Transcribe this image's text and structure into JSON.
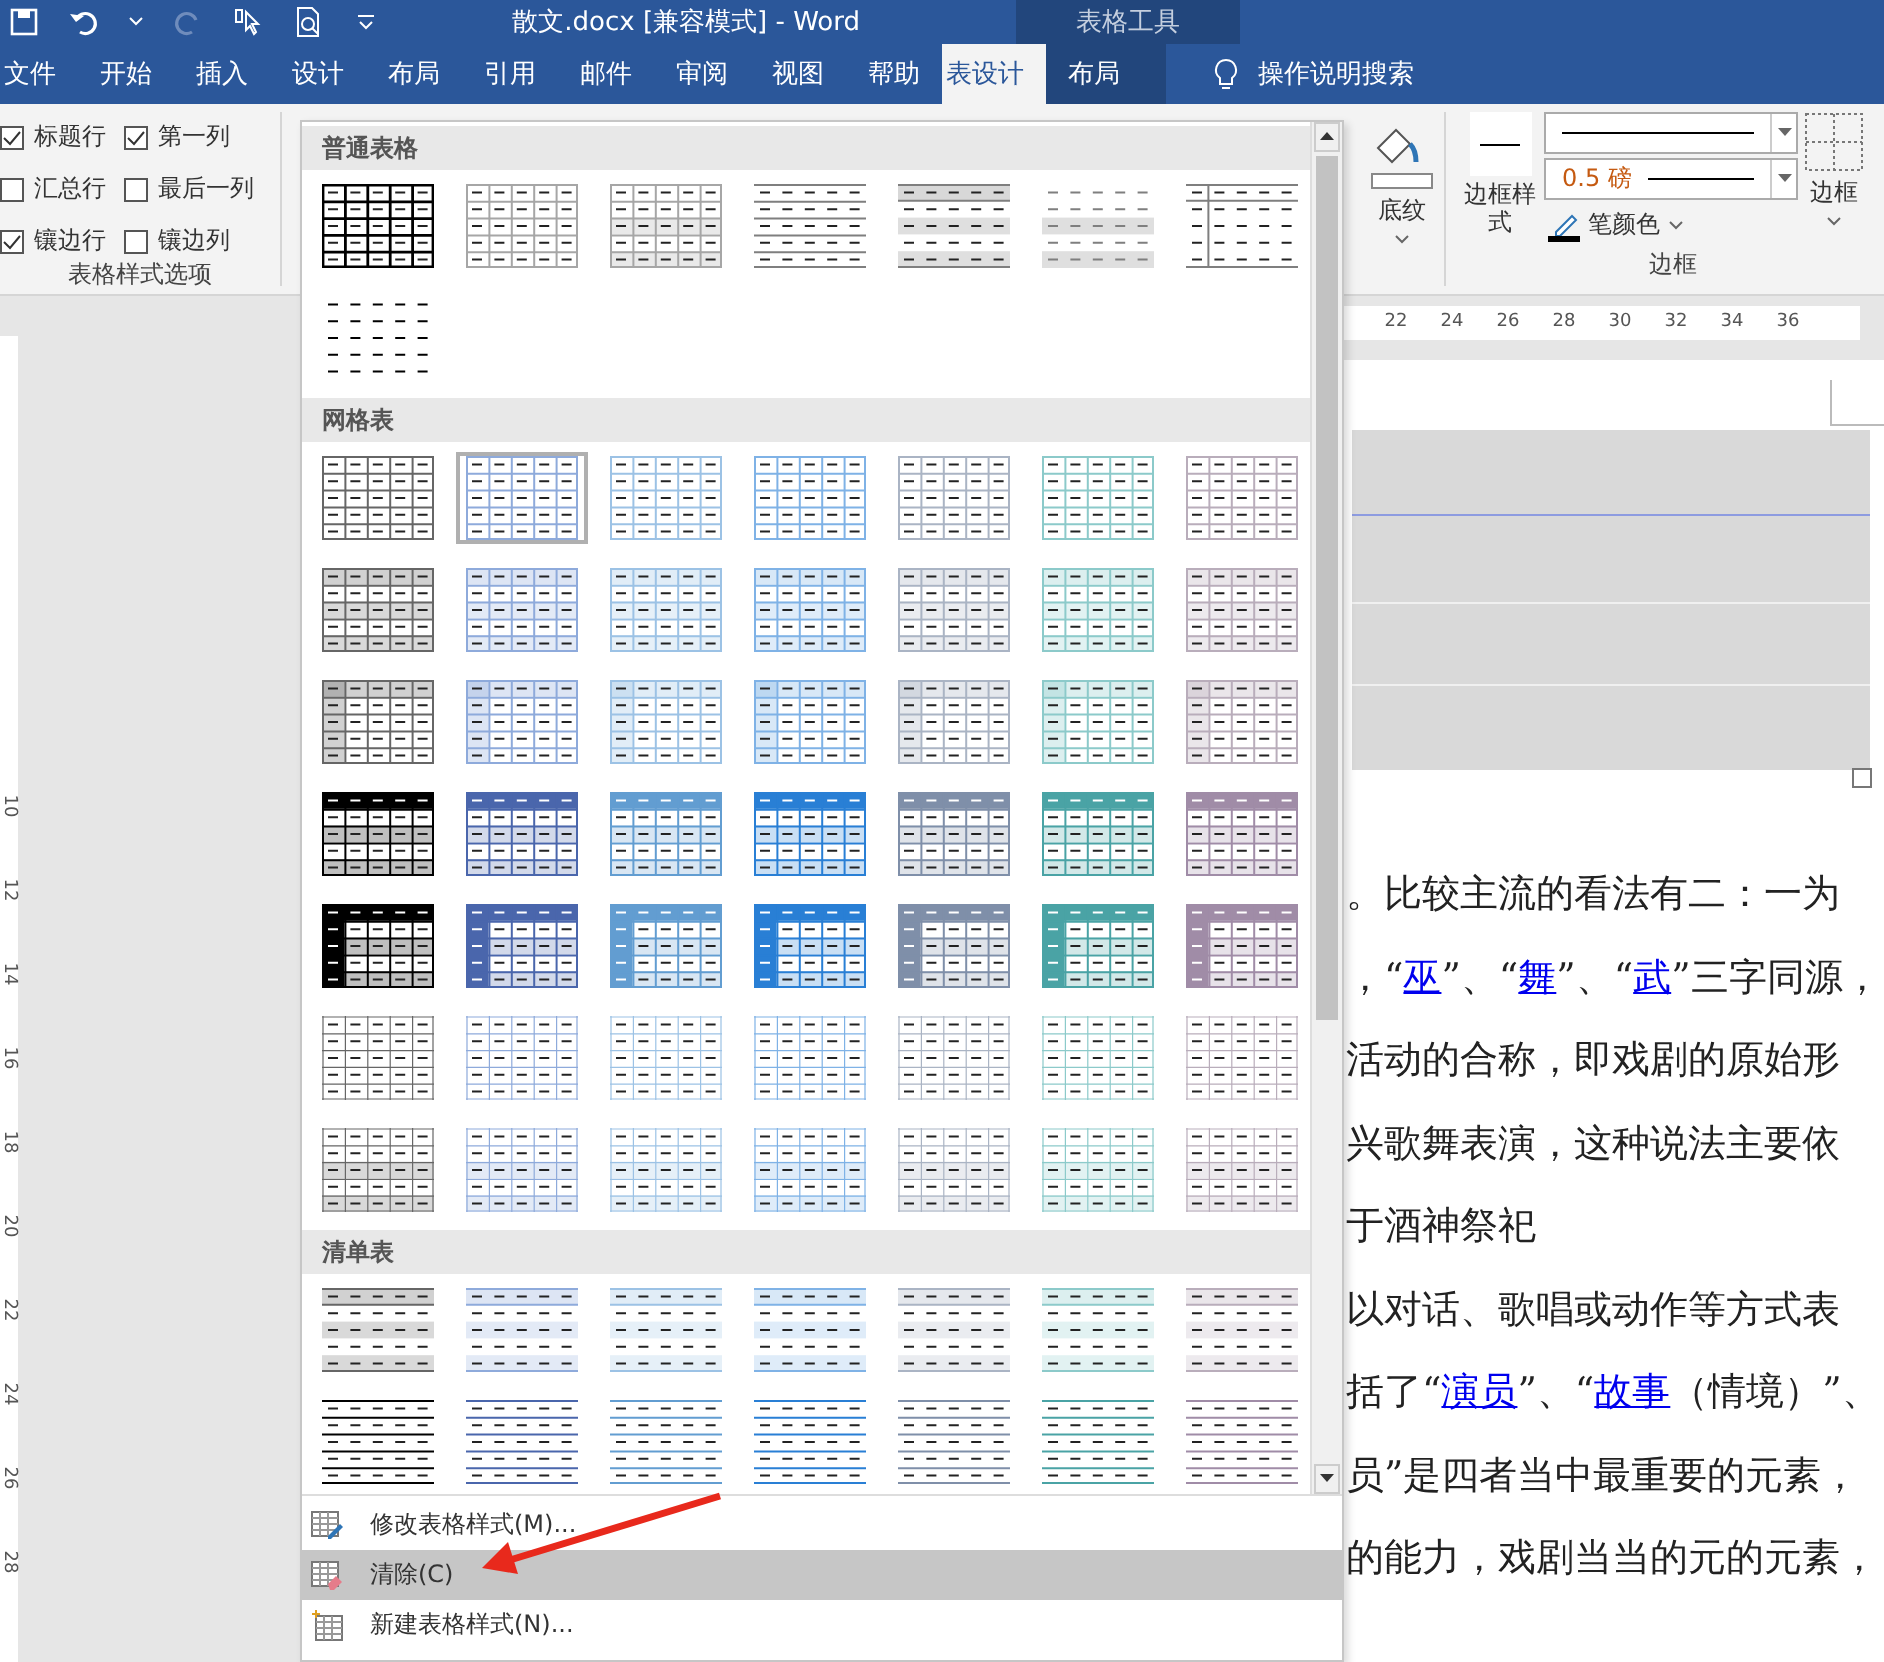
{
  "window": {
    "title": "散文.docx [兼容模式]  -  Word",
    "context_label": "表格工具"
  },
  "tabs": [
    {
      "label": "文件",
      "selected": false,
      "context": false
    },
    {
      "label": "开始",
      "selected": false,
      "context": false
    },
    {
      "label": "插入",
      "selected": false,
      "context": false
    },
    {
      "label": "设计",
      "selected": false,
      "context": false
    },
    {
      "label": "布局",
      "selected": false,
      "context": false
    },
    {
      "label": "引用",
      "selected": false,
      "context": false
    },
    {
      "label": "邮件",
      "selected": false,
      "context": false
    },
    {
      "label": "审阅",
      "selected": false,
      "context": false
    },
    {
      "label": "视图",
      "selected": false,
      "context": false
    },
    {
      "label": "帮助",
      "selected": false,
      "context": false
    },
    {
      "label": "表设计",
      "selected": true,
      "context": true
    },
    {
      "label": "布局",
      "selected": false,
      "context": true
    }
  ],
  "tell_me": "操作说明搜索",
  "style_options": {
    "label": "表格样式选项",
    "items": [
      {
        "label": "标题行",
        "checked": true
      },
      {
        "label": "第一列",
        "checked": true
      },
      {
        "label": "汇总行",
        "checked": false
      },
      {
        "label": "最后一列",
        "checked": false
      },
      {
        "label": "镶边行",
        "checked": true
      },
      {
        "label": "镶边列",
        "checked": false
      }
    ]
  },
  "shading": {
    "label": "底纹"
  },
  "borders": {
    "label": "边框",
    "style_button": "边框样式",
    "weight": "0.5 磅",
    "pen_color": "笔颜色",
    "borders_button": "边框"
  },
  "style_gallery": {
    "sections": [
      {
        "title": "普通表格",
        "styles": [
          {
            "kind": "grid-bold",
            "color": "#000000",
            "selected": false
          },
          {
            "kind": "grid",
            "color": "#a6a6a6",
            "selected": false
          },
          {
            "kind": "grid-banded",
            "color": "#a6a6a6",
            "selected": false
          },
          {
            "kind": "lines",
            "color": "#7f7f7f",
            "selected": false
          },
          {
            "kind": "list-banded",
            "color": "#7f7f7f",
            "selected": false
          },
          {
            "kind": "banded",
            "color": "#7f7f7f",
            "selected": false
          },
          {
            "kind": "firstcol",
            "color": "#7f7f7f",
            "selected": false
          },
          {
            "kind": "plain",
            "color": "#000000",
            "selected": false
          }
        ]
      },
      {
        "title": "网格表",
        "styles": [
          {
            "kind": "grid",
            "color": "#666666",
            "selected": false
          },
          {
            "kind": "grid",
            "color": "#8eaadb",
            "selected": true
          },
          {
            "kind": "grid",
            "color": "#9cc2e5",
            "selected": false
          },
          {
            "kind": "grid",
            "color": "#7fb2e6",
            "selected": false
          },
          {
            "kind": "grid",
            "color": "#aab4c4",
            "selected": false
          },
          {
            "kind": "grid",
            "color": "#8ccaca",
            "selected": false
          },
          {
            "kind": "grid",
            "color": "#b9adbb",
            "selected": false
          },
          {
            "kind": "grid-header-banded",
            "color": "#666666",
            "selected": false
          },
          {
            "kind": "grid-header-banded",
            "color": "#8eaadb",
            "selected": false
          },
          {
            "kind": "grid-header-banded",
            "color": "#9cc2e5",
            "selected": false
          },
          {
            "kind": "grid-header-banded",
            "color": "#7fb2e6",
            "selected": false
          },
          {
            "kind": "grid-header-banded",
            "color": "#aab4c4",
            "selected": false
          },
          {
            "kind": "grid-header-banded",
            "color": "#8ccaca",
            "selected": false
          },
          {
            "kind": "grid-header-banded",
            "color": "#b9adbb",
            "selected": false
          },
          {
            "kind": "grid-firstcol",
            "color": "#666666",
            "selected": false
          },
          {
            "kind": "grid-firstcol",
            "color": "#8eaadb",
            "selected": false
          },
          {
            "kind": "grid-firstcol",
            "color": "#9cc2e5",
            "selected": false
          },
          {
            "kind": "grid-firstcol",
            "color": "#7fb2e6",
            "selected": false
          },
          {
            "kind": "grid-firstcol",
            "color": "#aab4c4",
            "selected": false
          },
          {
            "kind": "grid-firstcol",
            "color": "#8ccaca",
            "selected": false
          },
          {
            "kind": "grid-firstcol",
            "color": "#b9adbb",
            "selected": false
          },
          {
            "kind": "grid-dark-header",
            "color": "#000000",
            "selected": false
          },
          {
            "kind": "grid-dark-header",
            "color": "#4a66ac",
            "selected": false
          },
          {
            "kind": "grid-dark-header",
            "color": "#629dd1",
            "selected": false
          },
          {
            "kind": "grid-dark-header",
            "color": "#297fd5",
            "selected": false
          },
          {
            "kind": "grid-dark-header",
            "color": "#7f8fa9",
            "selected": false
          },
          {
            "kind": "grid-dark-header",
            "color": "#4aa3a5",
            "selected": false
          },
          {
            "kind": "grid-dark-header",
            "color": "#a08ca7",
            "selected": false
          },
          {
            "kind": "grid-dark-both",
            "color": "#000000",
            "selected": false
          },
          {
            "kind": "grid-dark-both",
            "color": "#4a66ac",
            "selected": false
          },
          {
            "kind": "grid-dark-both",
            "color": "#629dd1",
            "selected": false
          },
          {
            "kind": "grid-dark-both",
            "color": "#297fd5",
            "selected": false
          },
          {
            "kind": "grid-dark-both",
            "color": "#7f8fa9",
            "selected": false
          },
          {
            "kind": "grid-dark-both",
            "color": "#4aa3a5",
            "selected": false
          },
          {
            "kind": "grid-dark-both",
            "color": "#a08ca7",
            "selected": false
          },
          {
            "kind": "grid-light",
            "color": "#666666",
            "selected": false
          },
          {
            "kind": "grid-light",
            "color": "#8eaadb",
            "selected": false
          },
          {
            "kind": "grid-light",
            "color": "#9cc2e5",
            "selected": false
          },
          {
            "kind": "grid-light",
            "color": "#7fb2e6",
            "selected": false
          },
          {
            "kind": "grid-light",
            "color": "#aab4c4",
            "selected": false
          },
          {
            "kind": "grid-light",
            "color": "#8ccaca",
            "selected": false
          },
          {
            "kind": "grid-light",
            "color": "#b9adbb",
            "selected": false
          },
          {
            "kind": "grid-light-banded",
            "color": "#666666",
            "selected": false
          },
          {
            "kind": "grid-light-banded",
            "color": "#8eaadb",
            "selected": false
          },
          {
            "kind": "grid-light-banded",
            "color": "#9cc2e5",
            "selected": false
          },
          {
            "kind": "grid-light-banded",
            "color": "#7fb2e6",
            "selected": false
          },
          {
            "kind": "grid-light-banded",
            "color": "#aab4c4",
            "selected": false
          },
          {
            "kind": "grid-light-banded",
            "color": "#8ccaca",
            "selected": false
          },
          {
            "kind": "grid-light-banded",
            "color": "#b9adbb",
            "selected": false
          }
        ]
      },
      {
        "title": "清单表",
        "styles": [
          {
            "kind": "list-banded",
            "color": "#666666",
            "selected": false
          },
          {
            "kind": "list-banded",
            "color": "#8eaadb",
            "selected": false
          },
          {
            "kind": "list-banded",
            "color": "#9cc2e5",
            "selected": false
          },
          {
            "kind": "list-banded",
            "color": "#7fb2e6",
            "selected": false
          },
          {
            "kind": "list-banded",
            "color": "#aab4c4",
            "selected": false
          },
          {
            "kind": "list-banded",
            "color": "#8ccaca",
            "selected": false
          },
          {
            "kind": "list-banded",
            "color": "#b9adbb",
            "selected": false
          },
          {
            "kind": "lines",
            "color": "#000000",
            "selected": false
          },
          {
            "kind": "lines",
            "color": "#4a66ac",
            "selected": false
          },
          {
            "kind": "lines",
            "color": "#629dd1",
            "selected": false
          },
          {
            "kind": "lines",
            "color": "#297fd5",
            "selected": false
          },
          {
            "kind": "lines",
            "color": "#7f8fa9",
            "selected": false
          },
          {
            "kind": "lines",
            "color": "#4aa3a5",
            "selected": false
          },
          {
            "kind": "lines",
            "color": "#a08ca7",
            "selected": false
          }
        ]
      }
    ],
    "menu": [
      {
        "kind": "modify",
        "label": "修改表格样式(M)...",
        "selected": false
      },
      {
        "kind": "clear",
        "label": "清除(C)",
        "selected": true
      },
      {
        "kind": "new",
        "label": "新建表格样式(N)...",
        "selected": false
      }
    ]
  },
  "ruler": [
    "22",
    "24",
    "26",
    "28",
    "30",
    "32",
    "34",
    "36"
  ],
  "vertical_ruler": [
    "10",
    "12",
    "14",
    "16",
    "18",
    "20",
    "22",
    "24",
    "26",
    "28"
  ],
  "document": {
    "lines": [
      [
        {
          "text": "。比较主流的看法有二：一为",
          "link": false
        }
      ],
      [
        {
          "text": "，“",
          "link": false
        },
        {
          "text": "巫",
          "link": true
        },
        {
          "text": "”、“",
          "link": false
        },
        {
          "text": "舞",
          "link": true
        },
        {
          "text": "”、“",
          "link": false
        },
        {
          "text": "武",
          "link": true
        },
        {
          "text": "”三字同源，",
          "link": false
        }
      ],
      [
        {
          "text": "活动的合称，即戏剧的原始形",
          "link": false
        }
      ],
      [
        {
          "text": "兴歌舞表演，这种说法主要依",
          "link": false
        }
      ],
      [
        {
          "text": "于酒神祭祀",
          "link": false
        }
      ],
      [
        {
          "text": "以对话、歌唱或动作等方式表",
          "link": false
        }
      ],
      [
        {
          "text": "括了“",
          "link": false
        },
        {
          "text": "演员",
          "link": true
        },
        {
          "text": "”、“",
          "link": false
        },
        {
          "text": "故事",
          "link": true
        },
        {
          "text": "（情境）”、",
          "link": false
        }
      ],
      [
        {
          "text": "员”是四者当中最重要的元素，",
          "link": false
        }
      ],
      [
        {
          "text": "的能力，戏剧当当的元的元素，",
          "link": false
        }
      ]
    ]
  }
}
